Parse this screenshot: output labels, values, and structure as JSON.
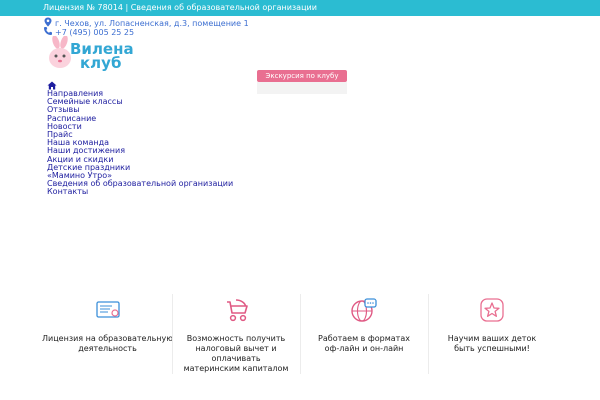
{
  "topbar": {
    "text": "Лицензия № 78014 | Сведения об образовательной организации",
    "bg_color": "#2bbcd2"
  },
  "contact": {
    "address": "г. Чехов, ул. Лопасненская, д.3, помещение 1",
    "phone": "+7 (495) 005 25 25",
    "icon_address": "map-marker-icon",
    "icon_phone": "phone-icon"
  },
  "logo": {
    "line1": "Вилена",
    "line2": "клуб"
  },
  "tour_button": {
    "label": "Экскурсия по клубу",
    "color": "#e96f91"
  },
  "nav": {
    "home_icon": "home-icon",
    "items": [
      "Направления",
      "Семейные классы",
      "Отзывы",
      "Расписание",
      "Новости",
      "Прайс",
      "Наша команда",
      "Наши достижения",
      "Акции и скидки",
      "Детские праздники",
      "«Мамино Утро»",
      "Сведения об образовательной организации",
      "Контакты"
    ]
  },
  "features": [
    {
      "icon": "certificate-icon",
      "label_lines": [
        "Лицензия на образовательную",
        "деятельность"
      ]
    },
    {
      "icon": "stroller-icon",
      "label_lines": [
        "Возможность получить",
        "налоговый вычет и оплачивать",
        "материнским капиталом"
      ]
    },
    {
      "icon": "globe-chat-icon",
      "label_lines": [
        "Работаем в форматах",
        "оф-лайн и он-лайн"
      ]
    },
    {
      "icon": "star-icon",
      "label_lines": [
        "Научим ваших деток",
        "быть успешными!"
      ]
    }
  ]
}
